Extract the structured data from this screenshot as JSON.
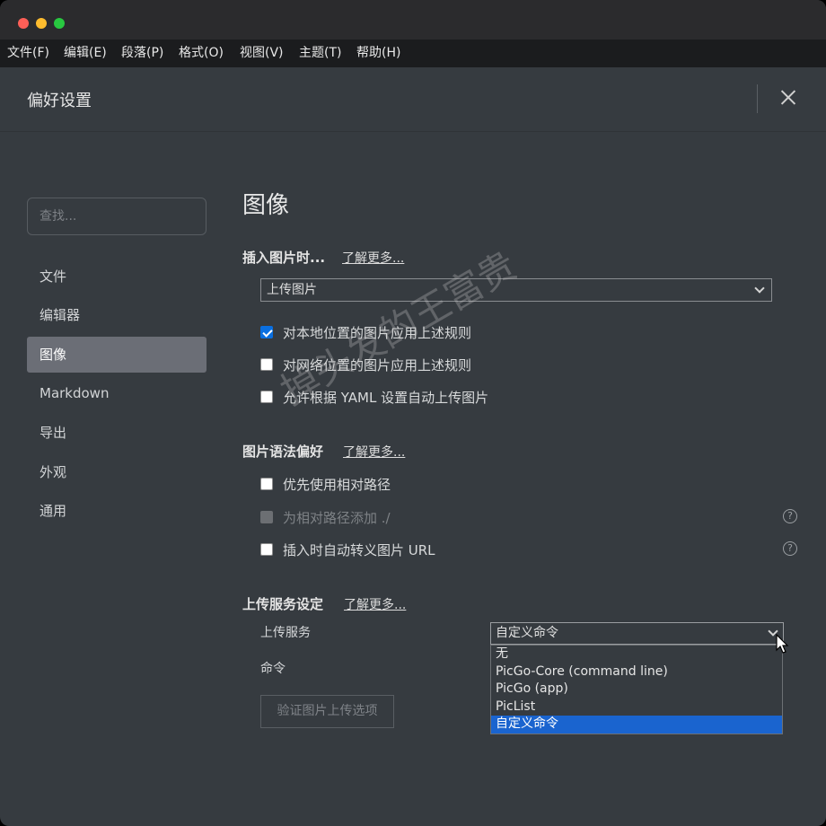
{
  "menubar": [
    {
      "label": "文件(F)"
    },
    {
      "label": "编辑(E)"
    },
    {
      "label": "段落(P)"
    },
    {
      "label": "格式(O)"
    },
    {
      "label": "视图(V)"
    },
    {
      "label": "主题(T)"
    },
    {
      "label": "帮助(H)"
    }
  ],
  "prefs": {
    "title": "偏好设置"
  },
  "sidebar": {
    "search_placeholder": "查找...",
    "items": [
      {
        "label": "文件"
      },
      {
        "label": "编辑器"
      },
      {
        "label": "图像"
      },
      {
        "label": "Markdown"
      },
      {
        "label": "导出"
      },
      {
        "label": "外观"
      },
      {
        "label": "通用"
      }
    ],
    "active_index": 2
  },
  "main": {
    "title": "图像",
    "insert": {
      "title": "插入图片时...",
      "learn_more": "了解更多...",
      "select_value": "上传图片",
      "options": [
        {
          "label": "对本地位置的图片应用上述规则",
          "checked": true
        },
        {
          "label": "对网络位置的图片应用上述规则",
          "checked": false
        },
        {
          "label": "允许根据 YAML 设置自动上传图片",
          "checked": false
        }
      ]
    },
    "syntax": {
      "title": "图片语法偏好",
      "learn_more": "了解更多...",
      "options": [
        {
          "label": "优先使用相对路径",
          "checked": false,
          "disabled": false
        },
        {
          "label": "为相对路径添加 ./",
          "checked": false,
          "disabled": true
        },
        {
          "label": "插入时自动转义图片 URL",
          "checked": false,
          "disabled": false
        }
      ]
    },
    "upload": {
      "title": "上传服务设定",
      "learn_more": "了解更多...",
      "service_label": "上传服务",
      "service_value": "自定义命令",
      "service_options": [
        "无",
        "PicGo-Core (command line)",
        "PicGo (app)",
        "PicList",
        "自定义命令"
      ],
      "selected_option_index": 4,
      "command_label": "命令",
      "verify_button": "验证图片上传选项"
    }
  },
  "watermark": "掉头发的王富贵",
  "colors": {
    "window_bg": "#363b40",
    "menubar_bg": "#1b1c1e",
    "active_item_bg": "#6b6e76",
    "accent_blue": "#1a64cf"
  },
  "icons": {
    "close": "close-icon",
    "help": "question-circle-icon",
    "dropdown": "chevron-down-icon",
    "cursor": "mouse-pointer-icon"
  }
}
